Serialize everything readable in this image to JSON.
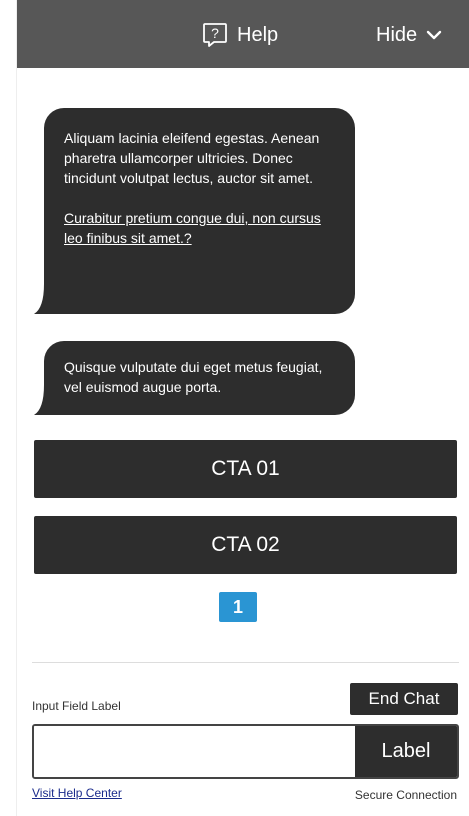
{
  "header": {
    "help_label": "Help",
    "help_icon": "question-bubble-icon",
    "hide_label": "Hide",
    "hide_icon": "chevron-down-icon"
  },
  "messages": [
    {
      "text": "Aliquam lacinia eleifend egestas. Aenean pharetra ullamcorper ultricies. Donec tincidunt volutpat lectus, auctor sit amet.",
      "link": "Curabitur pretium congue dui, non cursus leo finibus sit amet.?"
    },
    {
      "text": "Quisque vulputate dui eget metus feugiat, vel euismod augue porta."
    }
  ],
  "cta": {
    "cta_1_label": "CTA 01",
    "cta_2_label": "CTA 02"
  },
  "pagination": {
    "current": "1"
  },
  "footer": {
    "input_label": "Input Field Label",
    "end_chat_label": "End Chat",
    "input_value": "",
    "input_placeholder": "",
    "submit_label": "Label",
    "help_center_link": "Visit Help Center",
    "secure_text": "Secure Connection"
  },
  "colors": {
    "header_bg": "#575757",
    "bubble_bg": "#2d2d2d",
    "button_bg": "#2d2d2d",
    "badge_bg": "#2a95d3",
    "link_color": "#1a2b8c"
  }
}
